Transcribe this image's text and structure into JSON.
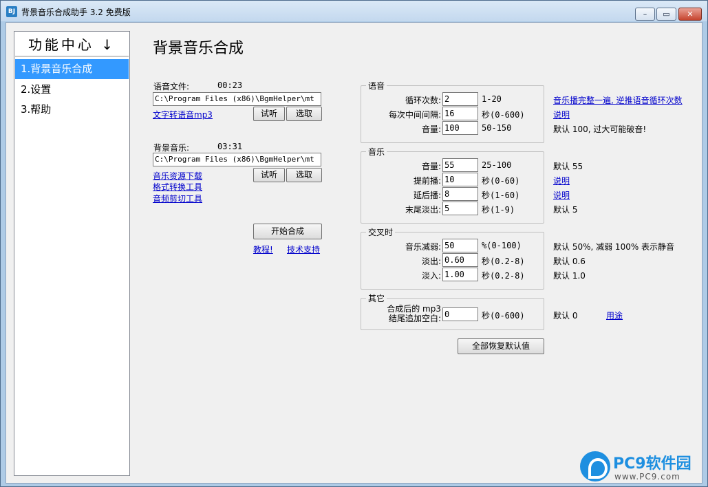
{
  "window": {
    "app_icon": "BJ",
    "title": "背景音乐合成助手 3.2 免费版",
    "min_icon": "–",
    "max_icon": "▭",
    "close_icon": "✕"
  },
  "sidebar": {
    "header": "功能中心 ↓",
    "items": [
      {
        "label": "1.背景音乐合成"
      },
      {
        "label": "2.设置"
      },
      {
        "label": "3.帮助"
      }
    ]
  },
  "page_title": "背景音乐合成",
  "voice_file": {
    "label": "语音文件:",
    "duration": "00:23",
    "path": "C:\\Program Files (x86)\\BgmHelper\\mt",
    "link": "文字转语音mp3",
    "listen": "试听",
    "choose": "选取"
  },
  "bg_music": {
    "label": "背景音乐:",
    "duration": "03:31",
    "path": "C:\\Program Files (x86)\\BgmHelper\\mt",
    "links": [
      "音乐资源下载",
      "格式转换工具",
      "音频剪切工具"
    ],
    "listen": "试听",
    "choose": "选取"
  },
  "actions": {
    "start": "开始合成",
    "tutorial": "教程!",
    "support": "技术支持",
    "reset": "全部恢复默认值"
  },
  "voice_group": {
    "title": "语音",
    "fields": [
      {
        "label": "循环次数:",
        "value": "2",
        "hint": "1-20"
      },
      {
        "label": "每次中间间隔:",
        "value": "16",
        "hint": "秒(0-600)"
      },
      {
        "label": "音量:",
        "value": "100",
        "hint": "50-150"
      }
    ],
    "notes": [
      "音乐播完整一遍, 逆推语音循环次数",
      "说明",
      "默认 100, 过大可能破音!"
    ]
  },
  "music_group": {
    "title": "音乐",
    "fields": [
      {
        "label": "音量:",
        "value": "55",
        "hint": "25-100"
      },
      {
        "label": "提前播:",
        "value": "10",
        "hint": "秒(0-60)"
      },
      {
        "label": "延后播:",
        "value": "8",
        "hint": "秒(1-60)"
      },
      {
        "label": "末尾淡出:",
        "value": "5",
        "hint": "秒(1-9)"
      }
    ],
    "notes": [
      "默认 55",
      "说明",
      "说明",
      "默认 5"
    ]
  },
  "cross_group": {
    "title": "交叉时",
    "fields": [
      {
        "label": "音乐减弱:",
        "value": "50",
        "hint": "%(0-100)"
      },
      {
        "label": "淡出:",
        "value": "0.60",
        "hint": "秒(0.2-8)"
      },
      {
        "label": "淡入:",
        "value": "1.00",
        "hint": "秒(0.2-8)"
      }
    ],
    "notes": [
      "默认 50%, 减弱 100% 表示静音",
      "默认 0.6",
      "默认 1.0"
    ]
  },
  "other_group": {
    "title": "其它",
    "label_line1": "合成后的 mp3",
    "label_line2": "结尾追加空白:",
    "value": "0",
    "hint": "秒(0-600)",
    "note": "默认 0",
    "link": "用途"
  },
  "watermark": {
    "brand": "PC9软件园",
    "url": "www.PC9.com"
  }
}
